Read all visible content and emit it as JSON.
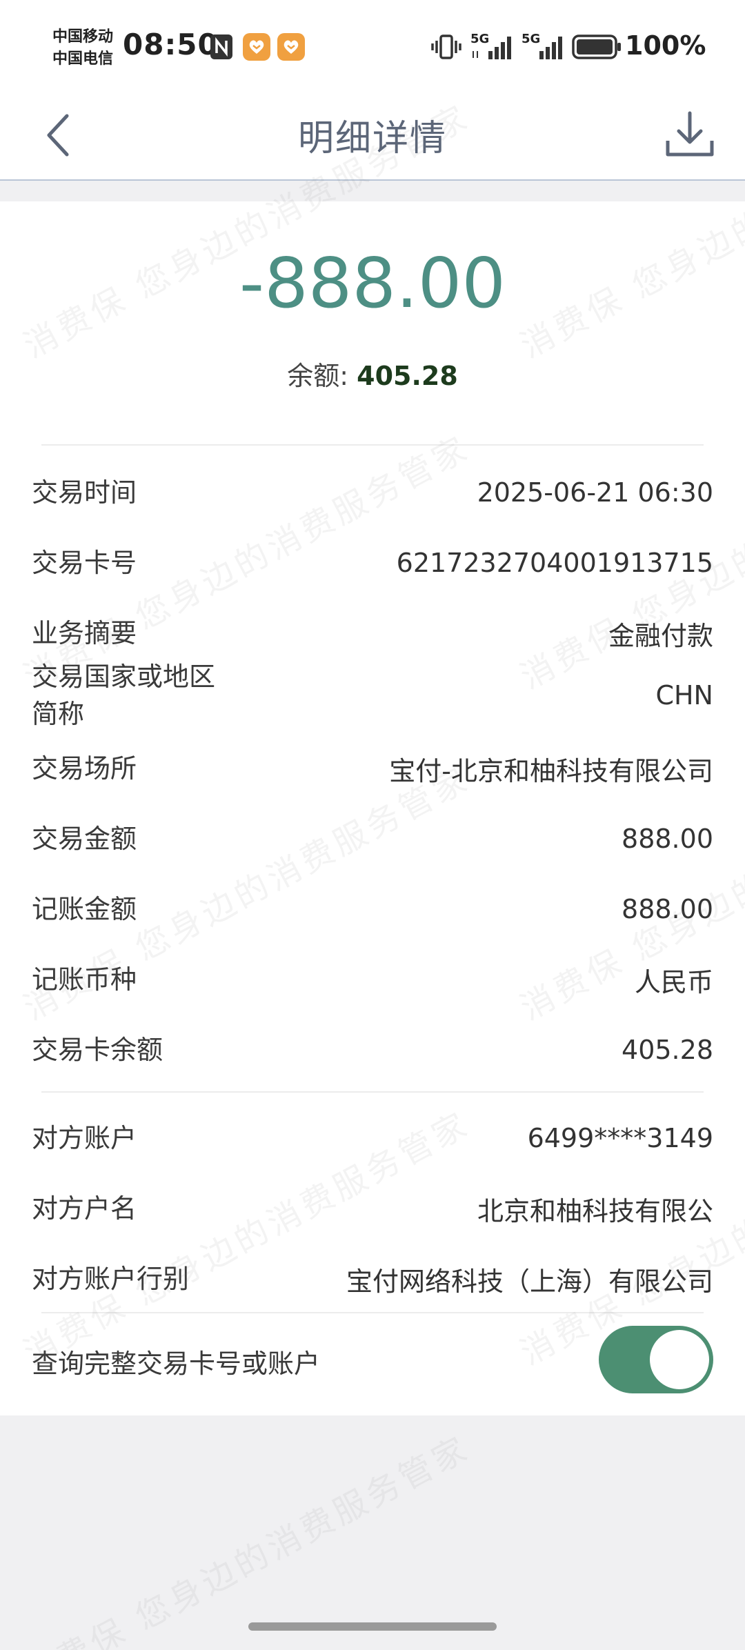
{
  "status_bar": {
    "carrier_1": "中国移动",
    "carrier_2": "中国电信",
    "time": "08:50",
    "signal_label_1": "5G",
    "signal_label_2": "5G",
    "battery": "100%"
  },
  "header": {
    "title": "明细详情"
  },
  "summary": {
    "amount": "-888.00",
    "balance_label": "余额: ",
    "balance_value": "405.28"
  },
  "details": [
    {
      "label": "交易时间",
      "value": "2025-06-21 06:30"
    },
    {
      "label": "交易卡号",
      "value": "6217232704001913715"
    },
    {
      "label": "业务摘要",
      "value": "金融付款"
    },
    {
      "label": "交易国家或地区简称",
      "value": "CHN"
    },
    {
      "label": "交易场所",
      "value": "宝付-北京和柚科技有限公司"
    },
    {
      "label": "交易金额",
      "value": "888.00"
    },
    {
      "label": "记账金额",
      "value": "888.00"
    },
    {
      "label": "记账币种",
      "value": "人民币"
    },
    {
      "label": "交易卡余额",
      "value": "405.28"
    }
  ],
  "counterparty": [
    {
      "label": "对方账户",
      "value": "6499****3149"
    },
    {
      "label": "对方户名",
      "value": "北京和柚科技有限公"
    },
    {
      "label": "对方账户行别",
      "value": "宝付网络科技（上海）有限公司"
    }
  ],
  "toggle": {
    "label": "查询完整交易卡号或账户",
    "state": "on"
  },
  "watermark": "消费保 您身边的消费服务管家",
  "colors": {
    "amount": "#4d8f84",
    "toggle_on": "#4c8f72",
    "title": "#5c6678"
  }
}
